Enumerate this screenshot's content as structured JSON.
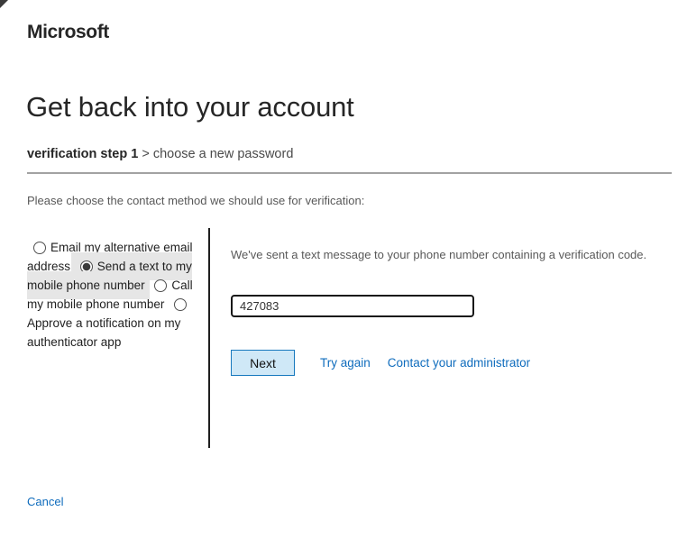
{
  "header": {
    "logo": "Microsoft"
  },
  "title": "Get back into your account",
  "breadcrumb": {
    "current_step": "verification step 1",
    "separator": ">",
    "next_step": "choose a new password"
  },
  "instruction": "Please choose the contact method we should use for verification:",
  "method_options": [
    {
      "label": "Email my alternative email address",
      "selected": false
    },
    {
      "label": "Send a text to my mobile phone number",
      "selected": true
    },
    {
      "label": "Call my mobile phone number",
      "selected": false
    },
    {
      "label": "Approve a notification on my authenticator app",
      "selected": false
    }
  ],
  "verification_panel": {
    "message": "We've sent a text message to your phone number containing a verification code.",
    "code_input": {
      "value": "427083",
      "placeholder": ""
    },
    "next_button_label": "Next",
    "try_again_label": "Try again",
    "contact_admin_label": "Contact your administrator"
  },
  "footer": {
    "cancel_label": "Cancel"
  },
  "colors": {
    "link_blue": "#0f6cbd",
    "next_button_bg": "#cfe8f7",
    "next_button_border": "#1779be",
    "selected_option_bg": "#e6e6e6",
    "text_dark": "#262626"
  }
}
